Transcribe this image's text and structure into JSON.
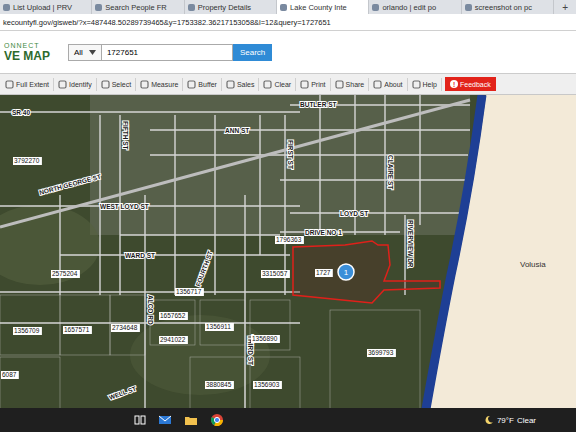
{
  "browser": {
    "tabs": [
      {
        "label": "List Upload | PRV",
        "selected": false
      },
      {
        "label": "Search People FR",
        "selected": false
      },
      {
        "label": "Property Details",
        "selected": false
      },
      {
        "label": "Lake County Inte",
        "selected": true
      },
      {
        "label": "orlando | edit po",
        "selected": false
      },
      {
        "label": "screenshot on pc",
        "selected": false
      }
    ],
    "new_tab": "+",
    "url": "kecountyfl.gov/gisweb/?x=487448.50289739465&y=1753382.36217153058&l=12&query=1727651"
  },
  "header": {
    "logo_top": "ONNECT",
    "logo_bottom": "VE MAP",
    "search_scope": "All",
    "search_value": "1727651",
    "search_button": "Search"
  },
  "toolbar": [
    {
      "label": "Full Extent",
      "kind": "tool"
    },
    {
      "label": "Identify",
      "kind": "tool"
    },
    {
      "label": "Select",
      "kind": "tool"
    },
    {
      "label": "Measure",
      "kind": "tool"
    },
    {
      "label": "Buffer",
      "kind": "tool"
    },
    {
      "label": "Sales",
      "kind": "tool"
    },
    {
      "label": "Clear",
      "kind": "tool"
    },
    {
      "label": "Print",
      "kind": "tool"
    },
    {
      "label": "Share",
      "kind": "tool"
    },
    {
      "label": "About",
      "kind": "tool"
    },
    {
      "label": "Help",
      "kind": "tool"
    },
    {
      "label": "Feedback",
      "kind": "alert",
      "badge": "!"
    }
  ],
  "map": {
    "streets": [
      "SR 40",
      "BUTLER ST",
      "ANN ST",
      "NORTH GEORGE ST",
      "FIFTH ST",
      "FIRST ST",
      "CLAIRE ST",
      "WEST LOYD ST",
      "LOYD ST",
      "DRIVE NO 1",
      "WARD ST",
      "FOURTH ST",
      "ALCO RD",
      "THIRD ST",
      "RIVERVIEW DR",
      "WELL ST"
    ],
    "parcels": [
      "3792270",
      "1796363",
      "2575204",
      "3315057",
      "1356717",
      "1356709",
      "1657571",
      "2734648",
      "1657652",
      "2941022",
      "1356911",
      "1356890",
      "3699793",
      "3880845",
      "1356903",
      "6087"
    ],
    "selected_parcel": {
      "label": "1727",
      "marker": "1"
    },
    "county_label": "Volusia"
  },
  "taskbar": {
    "temperature": "79°F",
    "weather": "Clear"
  }
}
